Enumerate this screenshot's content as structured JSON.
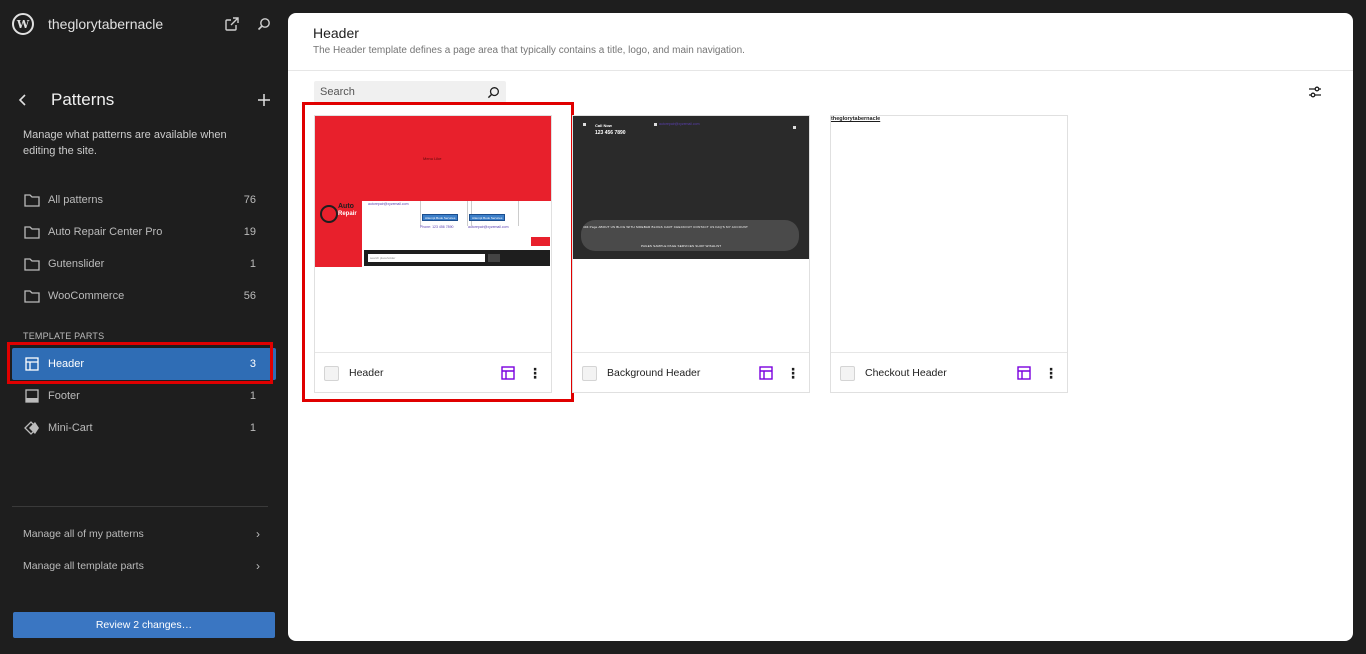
{
  "site": {
    "name": "theglorytabernacle"
  },
  "sidebar": {
    "title": "Patterns",
    "description": "Manage what patterns are available when editing the site.",
    "categories": [
      {
        "label": "All patterns",
        "count": "76"
      },
      {
        "label": "Auto Repair Center Pro",
        "count": "19"
      },
      {
        "label": "Gutenslider",
        "count": "1"
      },
      {
        "label": "WooCommerce",
        "count": "56"
      }
    ],
    "template_parts_label": "TEMPLATE PARTS",
    "template_parts": [
      {
        "label": "Header",
        "count": "3"
      },
      {
        "label": "Footer",
        "count": "1"
      },
      {
        "label": "Mini-Cart",
        "count": "1"
      }
    ],
    "manage": [
      {
        "label": "Manage all of my patterns"
      },
      {
        "label": "Manage all template parts"
      }
    ],
    "review_button": "Review 2 changes…"
  },
  "main": {
    "title": "Header",
    "description": "The Header template defines a page area that typically contains a title, logo, and main navigation.",
    "search_placeholder": "Search",
    "cards": [
      {
        "label": "Header"
      },
      {
        "label": "Background Header"
      },
      {
        "label": "Checkout Header"
      }
    ]
  },
  "previews": {
    "p1": {
      "red_text": "Menu Like",
      "logo_top": "Auto",
      "logo_bottom": "Repair",
      "email": "autorepair@xyzemail.com",
      "btn1": "Attempt Book Services",
      "btn2": "Attempt Book Services",
      "link1": "Phone: 123 456 7890",
      "link2": "autorepair@xyzemail.com",
      "search_text": "search placeholder"
    },
    "p2": {
      "call": "Call Now",
      "phone": "123 456 7890",
      "link": "autorepair@xyzemail.com",
      "nav1": "404 Page   ABOUT US   BLOG WITH SIDEBAR   BLOGS   CART   CHECKOUT   CONTACT US   FAQ'S   MY ACCOUNT",
      "nav2": "PAGES   SAMPLE PAGE   SERVICES   SHOP   WISHLIST"
    },
    "p3": {
      "site_name": "theglorytabernacle"
    }
  },
  "colors": {
    "accent": "#2f6db5",
    "highlight": "#e00000",
    "template_part_icon": "#7a00df"
  }
}
